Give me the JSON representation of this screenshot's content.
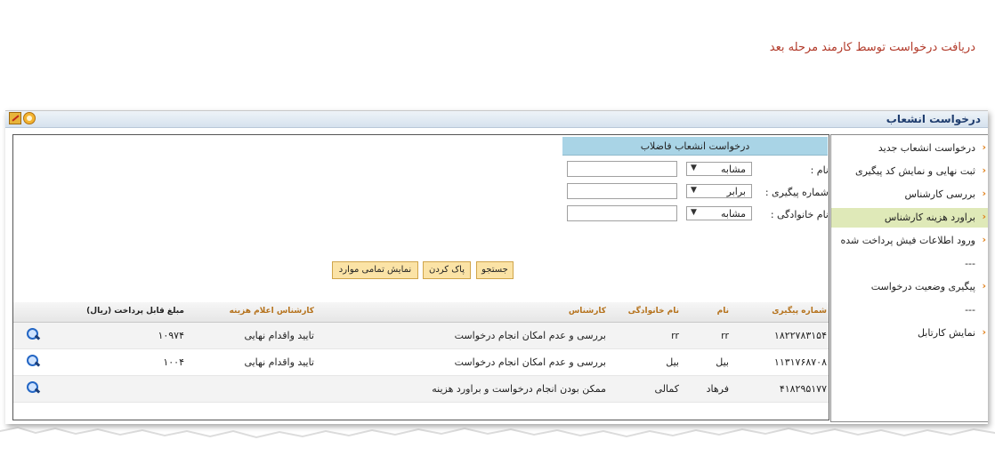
{
  "page": {
    "top_note": "دریافت درخواست توسط کارمند مرحله بعد"
  },
  "window": {
    "title": "درخواست انشعاب"
  },
  "sidebar": {
    "items": [
      {
        "label": "درخواست انشعاب جدید"
      },
      {
        "label": "ثبت نهایی و نمایش کد پیگیری"
      },
      {
        "label": "بررسی کارشناس"
      },
      {
        "label": "براورد هزینه کارشناس"
      },
      {
        "label": "ورود اطلاعات فیش پرداخت شده"
      },
      {
        "label": "---"
      },
      {
        "label": "پیگیری وضعیت درخواست"
      },
      {
        "label": "---"
      },
      {
        "label": "نمایش کارتابل"
      }
    ],
    "active_index": 3,
    "arrow_glyph": "‹"
  },
  "form": {
    "header": "درخواست انشعاب فاضلاب",
    "fields": [
      {
        "label": "نام :",
        "operator": "مشابه",
        "value": ""
      },
      {
        "label": "شماره پیگیری :",
        "operator": "برابر",
        "value": ""
      },
      {
        "label": "نام خانوادگی :",
        "operator": "مشابه",
        "value": ""
      }
    ],
    "dropdown_glyph": "▼"
  },
  "buttons": {
    "search": "جستجو",
    "clear": "پاک کردن",
    "show_all": "نمایش تمامی موارد"
  },
  "table": {
    "columns": {
      "tracking": "شماره پیگیری",
      "name": "نام",
      "family": "نام خانوادگی",
      "expert": "کارشناس",
      "cost_expert": "کارشناس اعلام هزینه",
      "amount": "مبلغ قابل پرداخت (ریال)"
    },
    "rows": [
      {
        "tracking": "۱۸۲۲۷۸۳۱۵۴",
        "name": "rr",
        "family": "rr",
        "expert": "بررسی و عدم امکان انجام درخواست",
        "cost_expert": "تایید واقدام نهایی",
        "amount": "۱۰۹۷۴"
      },
      {
        "tracking": "۱۱۳۱۷۶۸۷۰۸",
        "name": "بیل",
        "family": "بیل",
        "expert": "بررسی و عدم امکان انجام درخواست",
        "cost_expert": "تایید واقدام نهایی",
        "amount": "۱۰۰۴"
      },
      {
        "tracking": "۴۱۸۲۹۵۱۷۷",
        "name": "فرهاد",
        "family": "کمالی",
        "expert": "ممکن بودن انجام درخواست و براورد هزینه",
        "cost_expert": "",
        "amount": ""
      }
    ]
  }
}
